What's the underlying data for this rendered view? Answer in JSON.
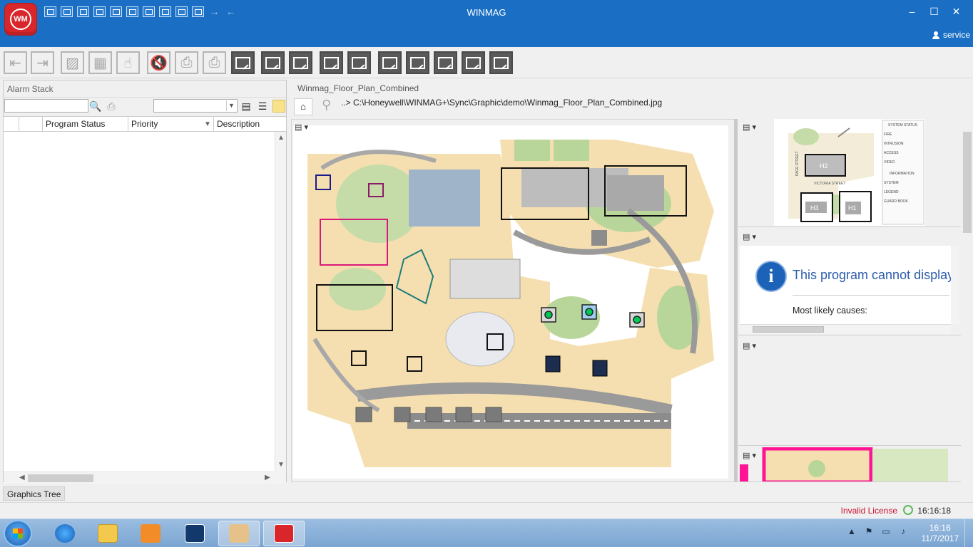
{
  "titlebar": {
    "app_logo": "WM",
    "title": "WINMAG",
    "user": "service",
    "controls": [
      "–",
      "☐",
      "✕"
    ]
  },
  "alarm_stack": {
    "title": "Alarm Stack",
    "search_value": "",
    "filter_value": "",
    "columns": [
      "Program Status",
      "Priority",
      "Description"
    ]
  },
  "bottom_tabs": {
    "graphics_tree": "Graphics Tree"
  },
  "graphic": {
    "title": "Winmag_Floor_Plan_Combined",
    "home": "⌂",
    "path": "..> C:\\Honeywell\\WINMAG+\\Sync\\Graphic\\demo\\Winmag_Floor_Plan_Combined.jpg"
  },
  "minimap": {
    "labels": [
      "H2",
      "H3",
      "H1",
      "PAGE STREET",
      "VICTORIA STREET",
      "SYSTEM STATUS",
      "FIRE",
      "INTRUSION",
      "ACCESS",
      "VIDEO",
      "INFORMATION",
      "SYSTEM",
      "LEGEND",
      "GUARD BOOK"
    ]
  },
  "browser_error": {
    "heading": "This program cannot display",
    "causes": "Most likely causes:"
  },
  "statusbar": {
    "license": "Invalid License",
    "time": "16:16:18"
  },
  "taskbar": {
    "clock_time": "16:16",
    "clock_date": "11/7/2017"
  },
  "colors": {
    "titlebar": "#1a6fc4",
    "logo": "#d8262b",
    "license": "#c8102e"
  }
}
